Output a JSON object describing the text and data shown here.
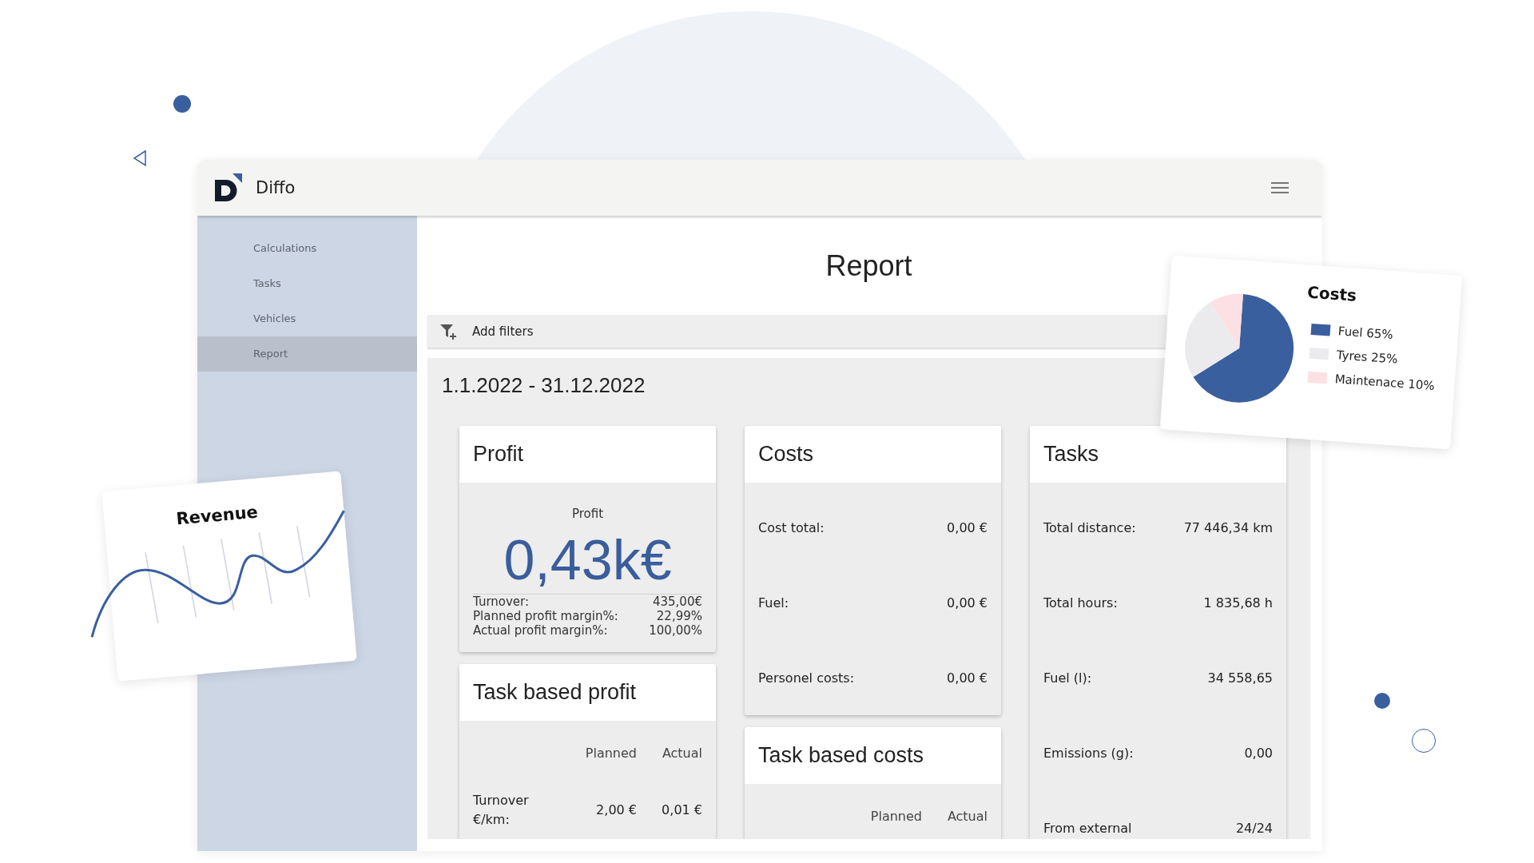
{
  "app": {
    "name": "Diffo"
  },
  "sidebar": {
    "items": [
      {
        "label": "Calculations",
        "selected": false
      },
      {
        "label": "Tasks",
        "selected": false
      },
      {
        "label": "Vehicles",
        "selected": false
      },
      {
        "label": "Report",
        "selected": true
      }
    ]
  },
  "page": {
    "title": "Report",
    "filter_button": "Add filters",
    "date_range": "1.1.2022 - 31.12.2022"
  },
  "card_columns": [
    [
      {
        "kind": "profit",
        "title": "Profit",
        "label": "Profit",
        "value": "0,43k€",
        "rows": [
          {
            "label": "Turnover:",
            "value": "435,00€"
          },
          {
            "label": "Planned profit margin%:",
            "value": "22,99%"
          },
          {
            "label": "Actual profit margin%:",
            "value": "100,00%"
          }
        ]
      },
      {
        "kind": "table",
        "title": "Task based profit",
        "columns": [
          "Planned",
          "Actual"
        ],
        "rows": [
          {
            "label": "Turnover €/km:",
            "values": [
              "2,00 €",
              "0,01 €"
            ]
          }
        ]
      }
    ],
    [
      {
        "kind": "list",
        "title": "Costs",
        "rows": [
          {
            "label": "Cost total:",
            "value": "0,00 €"
          },
          {
            "label": "Fuel:",
            "value": "0,00 €"
          },
          {
            "label": "Personel costs:",
            "value": "0,00 €"
          }
        ]
      },
      {
        "kind": "table",
        "title": "Task based costs",
        "columns": [
          "Planned",
          "Actual"
        ]
      }
    ],
    [
      {
        "kind": "list",
        "title": "Tasks",
        "rows": [
          {
            "label": "Total distance:",
            "value": "77 446,34 km"
          },
          {
            "label": "Total hours:",
            "value": "1 835,68 h"
          },
          {
            "label": "Fuel (l):",
            "value": "34 558,65"
          },
          {
            "label": "Emissions (g):",
            "value": "0,00"
          },
          {
            "label": "From external",
            "value": "24/24"
          }
        ]
      }
    ]
  ],
  "overlays": {
    "revenue_card": {
      "title": "Revenue"
    },
    "costs_chart_card": {
      "chart_data": {
        "type": "pie",
        "title": "Costs",
        "categories": [
          "Fuel 65%",
          "Tyres 25%",
          "Maintenace 10%"
        ],
        "values": [
          65,
          25,
          10
        ],
        "legend": true,
        "colors": [
          "#3a5f9e",
          "#ebebed",
          "#fde0e3"
        ]
      }
    }
  }
}
